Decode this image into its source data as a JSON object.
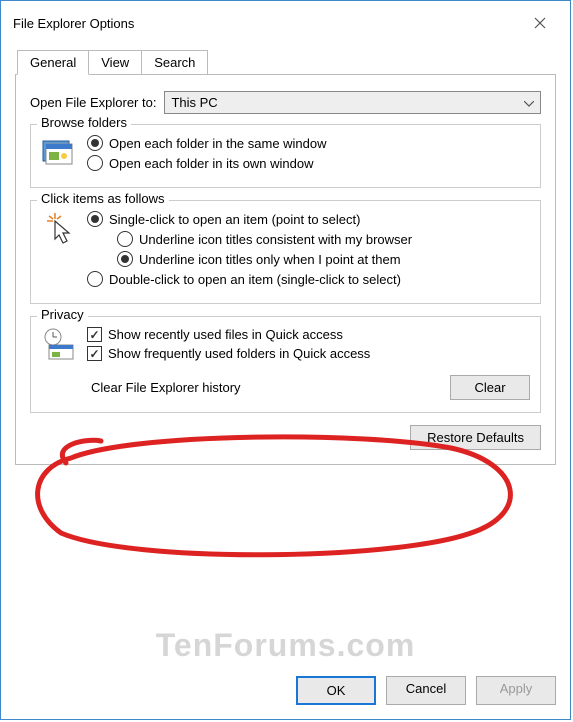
{
  "title": "File Explorer Options",
  "tabs": {
    "general": "General",
    "view": "View",
    "search": "Search"
  },
  "open_to": {
    "label": "Open File Explorer to:",
    "value": "This PC"
  },
  "browse_folders": {
    "legend": "Browse folders",
    "same_window": "Open each folder in the same window",
    "own_window": "Open each folder in its own window"
  },
  "click_items": {
    "legend": "Click items as follows",
    "single_click": "Single-click to open an item (point to select)",
    "underline_consistent": "Underline icon titles consistent with my browser",
    "underline_point": "Underline icon titles only when I point at them",
    "double_click": "Double-click to open an item (single-click to select)"
  },
  "privacy": {
    "legend": "Privacy",
    "show_recent": "Show recently used files in Quick access",
    "show_frequent": "Show frequently used folders in Quick access",
    "clear_history": "Clear File Explorer history",
    "clear_btn": "Clear"
  },
  "buttons": {
    "restore": "Restore Defaults",
    "ok": "OK",
    "cancel": "Cancel",
    "apply": "Apply"
  },
  "watermark": "TenForums.com"
}
